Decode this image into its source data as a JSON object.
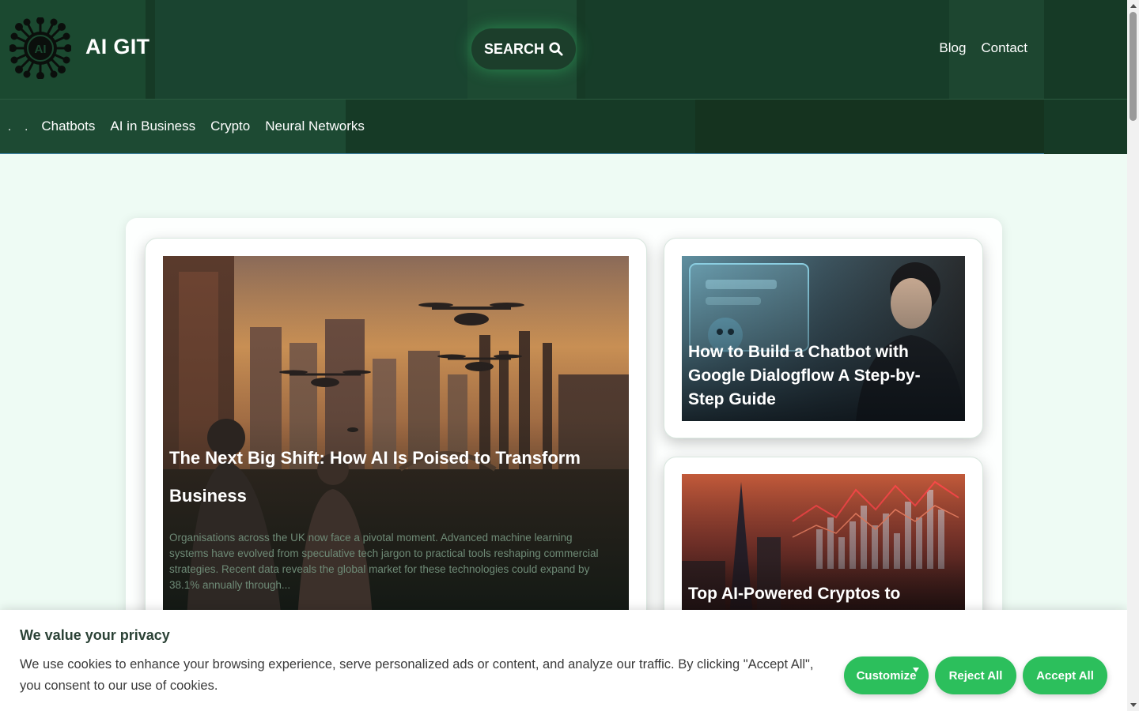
{
  "header": {
    "site_title": "AI GIT",
    "logo_text": "AI",
    "search_label": "SEARCH",
    "top_nav": [
      "Blog",
      "Contact"
    ]
  },
  "category_nav": {
    "dots": [
      ".",
      "."
    ],
    "items": [
      "Chatbots",
      "AI in Business",
      "Crypto",
      "Neural Networks"
    ]
  },
  "articles": {
    "featured": {
      "title": "The Next Big Shift: How AI Is Poised to Transform Business",
      "excerpt": "Organisations across the UK now face a pivotal moment. Advanced machine learning systems have evolved from speculative tech jargon to practical tools reshaping commercial strategies. Recent data reveals the global market for these technologies could expand by 38.1% annually through..."
    },
    "side": [
      {
        "title": "How to Build a Chatbot with Google Dialogflow A Step-by-Step Guide"
      },
      {
        "title": "Top AI-Powered Cryptos to"
      }
    ]
  },
  "cookie_banner": {
    "heading": "We value your privacy",
    "text": "We use cookies to enhance your browsing experience, serve personalized ads or content, and analyze our traffic. By clicking \"Accept All\", you consent to our use of cookies.",
    "customize_label": "Customize",
    "reject_label": "Reject All",
    "accept_label": "Accept All"
  },
  "colors": {
    "header_bg": "#163a26",
    "page_bg": "#eefbf4",
    "accent_green": "#2cbf5c"
  }
}
